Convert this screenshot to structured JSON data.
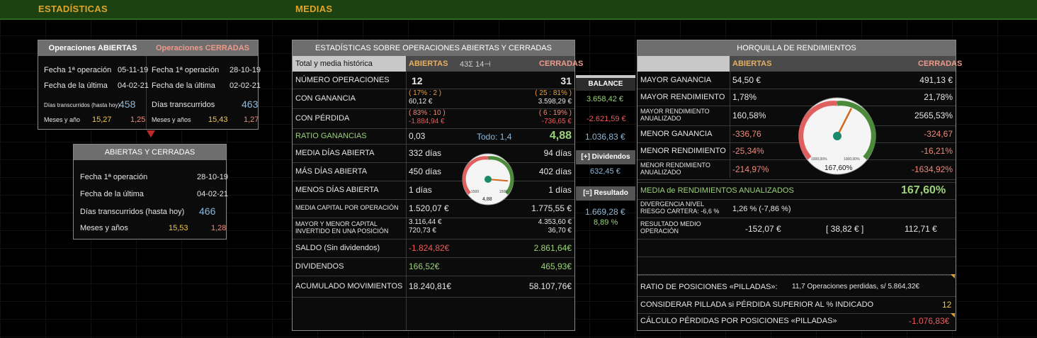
{
  "topbar": {
    "left": "ESTADÍSTICAS",
    "right": "MEDIAS"
  },
  "stats_box": {
    "open_header": "Operaciones ABIERTAS",
    "closed_header": "Operaciones CERRADAS",
    "first_op_label": "Fecha 1ª operación",
    "last_label": "Fecha de la última",
    "days_label_open": "Días transcurridos (hasta hoy)",
    "days_label_closed": "Días transcurridos",
    "months_label": "Meses y año",
    "months_label_closed": "Meses y años",
    "open_first": "05-11-19",
    "open_last": "04-02-21",
    "open_days": "458",
    "open_months": "15,27",
    "open_years": "1,25",
    "closed_first": "28-10-19",
    "closed_last": "02-02-21",
    "closed_days": "463",
    "closed_months": "15,43",
    "closed_years": "1,27"
  },
  "combined_box": {
    "header": "ABIERTAS Y CERRADAS",
    "first_label": "Fecha 1ª operación",
    "first": "28-10-19",
    "last_label": "Fecha de la última",
    "last": "04-02-21",
    "days_label": "Días transcurridos (hasta hoy)",
    "days": "466",
    "months_label": "Meses y años",
    "months": "15,53",
    "years": "1,28"
  },
  "main_table": {
    "title": "ESTADÍSTICAS SOBRE OPERACIONES ABIERTAS Y CERRADAS",
    "sub_label": "Total y media histórica",
    "col_open": "ABIERTAS",
    "sigma": "43Σ  14⊣",
    "col_closed": "CERRADAS",
    "rows": [
      {
        "label": "NÚMERO OPERACIONES",
        "open": "12",
        "closed": "31"
      },
      {
        "label": "CON GANANCIA",
        "open": "( 17% : 2 )",
        "open2": "60,12 €",
        "closed": "( 25 : 81% )",
        "closed2": "3.598,29 €"
      },
      {
        "label": "CON PÉRDIDA",
        "open": "( 83% : 10 )",
        "open2": "-1.884,94 €",
        "closed": "( 6 : 19% )",
        "closed2": "-736,65 €"
      },
      {
        "label": "RATIO GANANCIAS",
        "open": "0,03",
        "mid": "Todo: 1,4",
        "closed": "4,88"
      },
      {
        "label": "MEDIA DÍAS ABIERTA",
        "open": "332 días",
        "closed": "94 días"
      },
      {
        "label": "MÁS DÍAS ABIERTA",
        "open": "450 días",
        "closed": "402 días"
      },
      {
        "label": "MENOS DÍAS ABIERTA",
        "open": "1 días",
        "closed": "1 días"
      },
      {
        "label": "MEDIA CAPITAL POR OPERACIÓN",
        "open": "1.520,07 €",
        "closed": "1.775,55 €"
      },
      {
        "label": "MAYOR Y MENOR CAPITAL INVERTIDO EN UNA POSICIÓN",
        "open": "3.116,44 €",
        "open2": "720,73 €",
        "closed": "4.353,60 €",
        "closed2": "36,70 €"
      },
      {
        "label": "SALDO  (Sin dividendos)",
        "open": "-1.824,82€",
        "closed": "2.861,64€"
      },
      {
        "label": "DIVIDENDOS",
        "open": "166,52€",
        "closed": "465,93€"
      },
      {
        "label": "ACUMULADO MOVIMIENTOS",
        "open": "18.240,81€",
        "closed": "58.107,76€"
      }
    ],
    "gauge_value": "4,88",
    "gauge_min": "1500",
    "gauge_max": "1500",
    "gauge_fraction": 0.85
  },
  "balance": {
    "header": "BALANCE",
    "gain": "3.658,42 €",
    "loss": "-2.621,59 €",
    "net": "1.036,83 €",
    "dividends_btn": "[+]  Dividendos",
    "dividends": "632,45 €",
    "result_btn": "[=]  Resultado",
    "result": "1.669,28 €",
    "result_pct": "8,89 %"
  },
  "yield_table": {
    "title": "HORQUILLA DE RENDIMIENTOS",
    "col_open": "ABIERTAS",
    "col_closed": "CERRADAS",
    "rows": [
      {
        "label": "MAYOR GANANCIA",
        "open": "54,50 €",
        "closed": "491,13 €"
      },
      {
        "label": "MAYOR RENDIMIENTO",
        "open": "1,78%",
        "closed": "21,78%"
      },
      {
        "label": "MAYOR RENDIMIENTO ANUALIZADO",
        "open": "160,58%",
        "closed": "2565,53%"
      },
      {
        "label": "MENOR GANANCIA",
        "open": "-336,76",
        "closed": "-324,67"
      },
      {
        "label": "MENOR RENDIMIENTO",
        "open": "-25,34%",
        "closed": "-16,21%"
      },
      {
        "label": "MENOR RENDIMIENTO ANUALIZADO",
        "open": "-214,97%",
        "closed": "-1634,92%"
      }
    ],
    "avg_label": "MEDIA de RENDIMIENTOS ANUALIZADOS",
    "avg_value": "167,60%",
    "gauge_value": "167,60%",
    "gauge_min": "1000,00%",
    "gauge_max": "1000,00%",
    "gauge_fraction": 0.6,
    "divergence_label": "DIVERGENCIA NIVEL RIESGO CARTERA: -6,6 %",
    "divergence_value": "1,26 %  (-7,86 %)",
    "result_label": "RESULTADO MEDIO OPERACIÓN",
    "result_open": "-152,07 €",
    "result_mid": "[  38,82 € ]",
    "result_closed": "112,71 €",
    "ratio_label": "RATIO DE POSICIONES «PILLADAS»:",
    "ratio_value": "11,7 Operaciones perdidas, s/ 5.864,32€",
    "consider_label": "CONSIDERAR PILLADA si PÉRDIDA SUPERIOR AL % INDICADO",
    "consider_value": "12",
    "calc_label": "CÁLCULO PÉRDIDAS POR POSICIONES «PILLADAS»",
    "calc_value": "-1.076,83€"
  },
  "colors": {
    "accent_orange": "#e0a42a",
    "green": "#9bd27a",
    "red": "#ef5a5a",
    "blue": "#8fb8d8"
  }
}
